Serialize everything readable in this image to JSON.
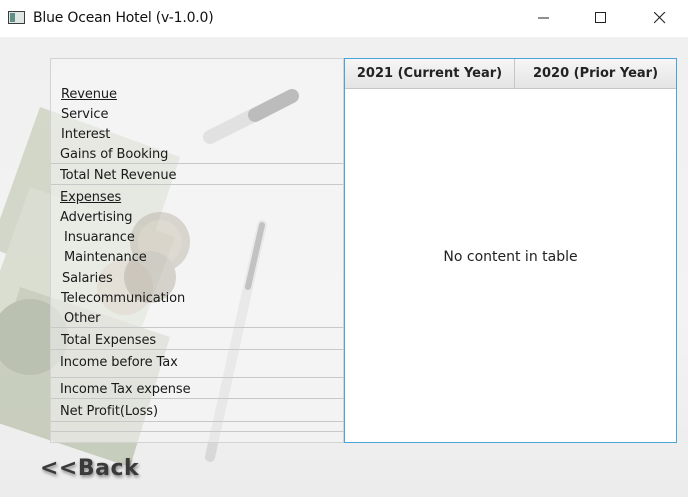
{
  "window": {
    "title": "Blue Ocean Hotel (v-1.0.0)"
  },
  "labels": {
    "revenue_header": "Revenue",
    "service": "Service",
    "interest": "Interest",
    "gains_of_booking": "Gains of Booking",
    "total_net_revenue": "Total Net Revenue",
    "expenses_header": "Expenses",
    "advertising": "Advertising",
    "insurance": "Insuarance",
    "maintenance": "Maintenance",
    "salaries": "Salaries",
    "telecommunication": "Telecommunication",
    "other": "Other",
    "total_expenses": "Total Expenses",
    "income_before_tax": "Income before Tax",
    "income_tax_expense": "Income Tax expense",
    "net_profit_loss": "Net Profit(Loss)"
  },
  "table": {
    "columns": [
      "2021 (Current Year)",
      "2020 (Prior Year)"
    ],
    "empty_message": "No content in table"
  },
  "back_button": {
    "label": "<<Back"
  }
}
